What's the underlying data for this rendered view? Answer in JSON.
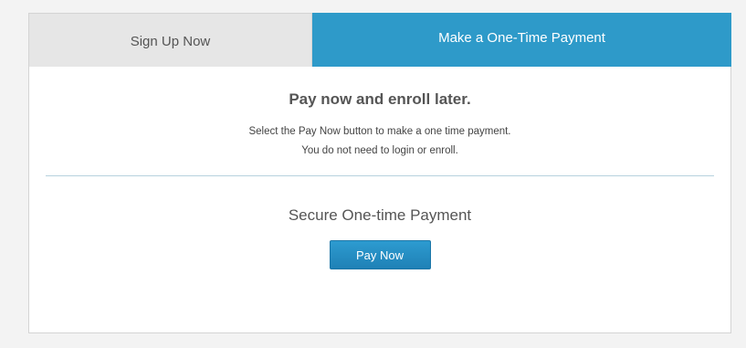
{
  "tabs": {
    "sign_up": "Sign Up Now",
    "one_time": "Make a One-Time Payment"
  },
  "panel": {
    "heading": "Pay now and enroll later.",
    "line1": "Select the Pay Now button to make a one time payment.",
    "line2": "You do not need to login or enroll.",
    "secure_title": "Secure One-time Payment",
    "pay_button": "Pay Now"
  },
  "colors": {
    "active_tab": "#2e9ac9",
    "inactive_tab": "#e6e6e6",
    "button": "#1f81b6"
  }
}
